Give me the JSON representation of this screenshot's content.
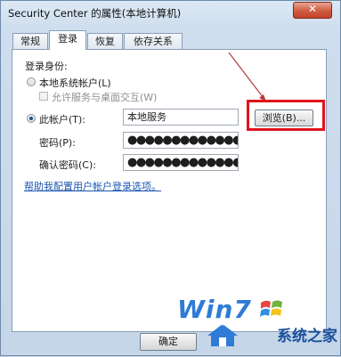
{
  "window": {
    "title": "Security Center 的属性(本地计算机)",
    "close_label": "✕"
  },
  "tabs": [
    {
      "label": "常规"
    },
    {
      "label": "登录"
    },
    {
      "label": "恢复"
    },
    {
      "label": "依存关系"
    }
  ],
  "logon": {
    "section_label": "登录身份:",
    "local_system_label": "本地系统帐户(L)",
    "allow_desktop_label": "允许服务与桌面交互(W)",
    "this_account_label": "此帐户(T):",
    "this_account_value": "本地服务",
    "browse_label": "浏览(B)...",
    "password_label": "密码(P):",
    "password_value": "●●●●●●●●●●●●●●●",
    "confirm_label": "确认密码(C):",
    "confirm_value": "●●●●●●●●●●●●●●●",
    "help_link": "帮助我配置用户帐户登录选项。"
  },
  "footer": {
    "ok_label": "确定"
  },
  "watermark": {
    "brand": "Win7",
    "site": "系统之家"
  },
  "colors": {
    "highlight": "#e0141c",
    "link": "#1b56b1",
    "annotation_arrow": "#b83a3a"
  }
}
